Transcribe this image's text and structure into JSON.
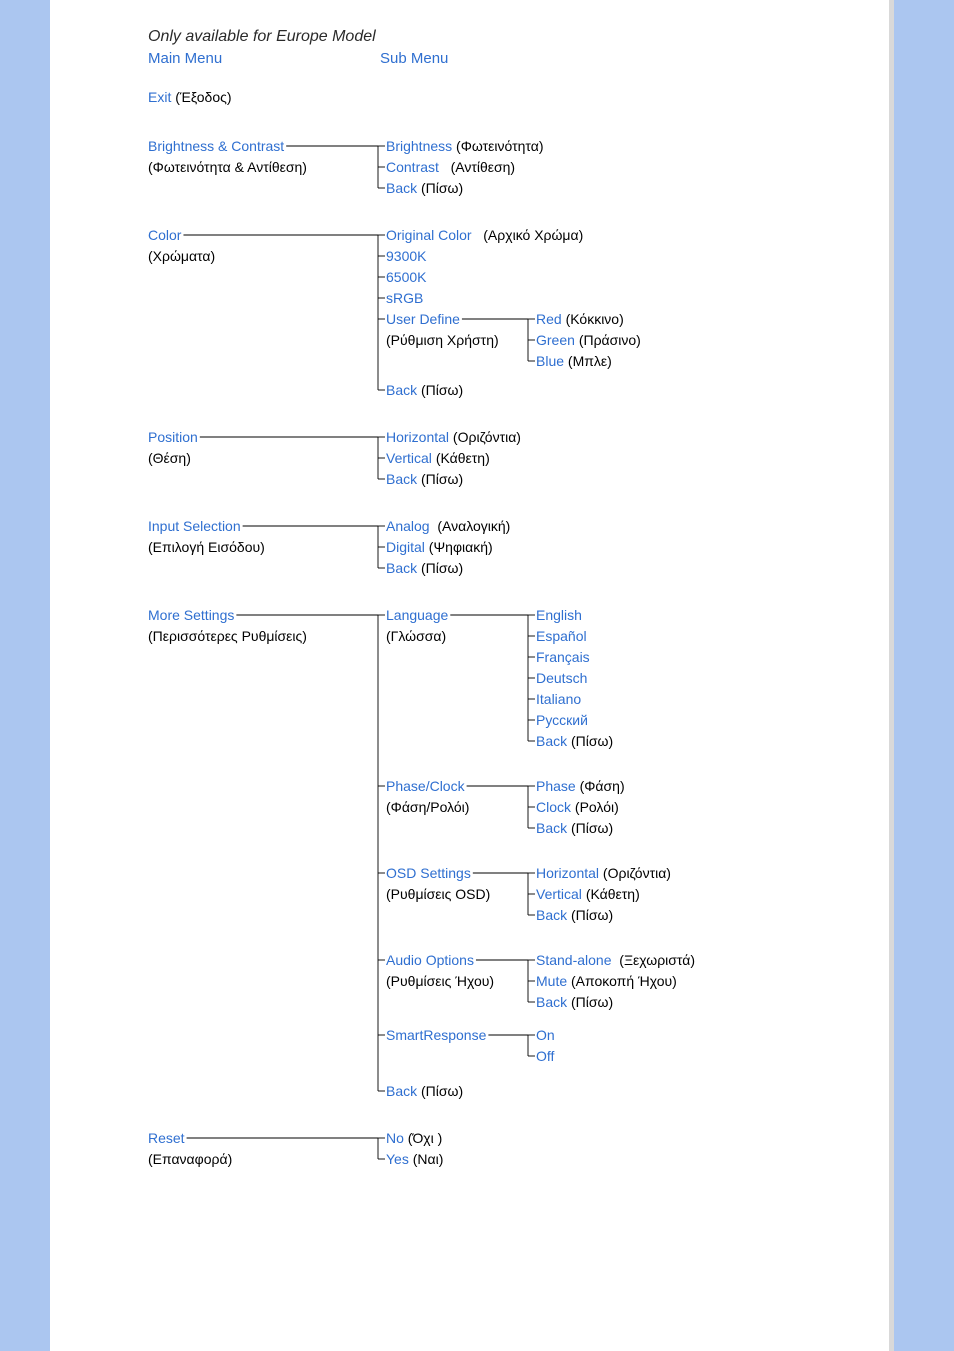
{
  "note": "Only available for Europe Model",
  "headers": {
    "main": "Main Menu",
    "sub": "Sub Menu"
  },
  "exit": {
    "label": "Exit",
    "trans": "(Έξοδος)"
  },
  "bc": {
    "label": "Brightness &  Contrast",
    "trans": "(Φωτεινότητα & Αντίθεση)",
    "sub": {
      "brightness": {
        "label": "Brightness",
        "trans": "(Φωτεινότητα)"
      },
      "contrast": {
        "label": "Contrast",
        "trans": "(Αντίθεση)"
      },
      "back": {
        "label": "Back",
        "trans": "(Πίσω)"
      }
    }
  },
  "color": {
    "label": "Color",
    "trans": "(Χρώματα)",
    "sub": {
      "orig": {
        "label": "Original Color",
        "trans": "(Αρχικό Χρώμα)"
      },
      "k9300": {
        "label": "9300K"
      },
      "k6500": {
        "label": "6500K"
      },
      "srgb": {
        "label": "sRGB"
      },
      "ud": {
        "label": "User Define",
        "trans": "(Ρύθμιση Χρήστη)",
        "third": {
          "red": {
            "label": "Red",
            "trans": "(Κόκκινο)"
          },
          "green": {
            "label": "Green",
            "trans": "(Πράσινο)"
          },
          "blue": {
            "label": "Blue",
            "trans": "(Μπλε)"
          }
        }
      },
      "back": {
        "label": "Back",
        "trans": "(Πίσω)"
      }
    }
  },
  "pos": {
    "label": "Position",
    "trans": "(Θέση)",
    "sub": {
      "h": {
        "label": "Horizontal",
        "trans": "(Οριζόντια)"
      },
      "v": {
        "label": "Vertical",
        "trans": "(Κάθετη)"
      },
      "back": {
        "label": "Back",
        "trans": "(Πίσω)"
      }
    }
  },
  "input": {
    "label": "Input Selection",
    "trans": "(Επιλογή Εισόδου)",
    "sub": {
      "analog": {
        "label": "Analog",
        "trans": "(Αναλογική)"
      },
      "digital": {
        "label": "Digital",
        "trans": "(Ψηφιακή)"
      },
      "back": {
        "label": "Back",
        "trans": "(Πίσω)"
      }
    }
  },
  "more": {
    "label": "More Settings",
    "trans": "(Περισσότερες Ρυθμίσεις)",
    "sub": {
      "lang": {
        "label": "Language",
        "trans": "(Γλώσσα)",
        "third": {
          "en": {
            "label": "English"
          },
          "es": {
            "label": "Español"
          },
          "fr": {
            "label": "Français"
          },
          "de": {
            "label": "Deutsch"
          },
          "it": {
            "label": "Italiano"
          },
          "ru": {
            "label": "Русский"
          },
          "back": {
            "label": "Back",
            "trans": "(Πίσω)"
          }
        }
      },
      "phase": {
        "label": "Phase/Clock",
        "trans": "(Φάση/Ρολόι)",
        "third": {
          "phase": {
            "label": "Phase",
            "trans": "(Φάση)"
          },
          "clock": {
            "label": "Clock",
            "trans": "(Ρολόι)"
          },
          "back": {
            "label": "Back",
            "trans": "(Πίσω)"
          }
        }
      },
      "osd": {
        "label": "OSD Settings",
        "trans": "(Ρυθμίσεις OSD)",
        "third": {
          "h": {
            "label": "Horizontal",
            "trans": "(Οριζόντια)"
          },
          "v": {
            "label": "Vertical",
            "trans": "(Κάθετη)"
          },
          "back": {
            "label": "Back",
            "trans": "(Πίσω)"
          }
        }
      },
      "audio": {
        "label": "Audio Options",
        "trans": "(Ρυθμίσεις Ήχου)",
        "third": {
          "sa": {
            "label": "Stand-alone",
            "trans": "(Ξεχωριστά)"
          },
          "mute": {
            "label": "Mute",
            "trans": "(Αποκοπή Ήχου)"
          },
          "back": {
            "label": "Back",
            "trans": "(Πίσω)"
          }
        }
      },
      "smart": {
        "label": "SmartResponse",
        "third": {
          "on": {
            "label": "On"
          },
          "off": {
            "label": "Off"
          }
        }
      },
      "back": {
        "label": "Back",
        "trans": "(Πίσω)"
      }
    }
  },
  "reset": {
    "label": "Reset",
    "trans": "(Επαναφορά)",
    "sub": {
      "no": {
        "label": "No",
        "trans": "(Όχι )"
      },
      "yes": {
        "label": "Yes",
        "trans": "(Ναι)"
      }
    }
  }
}
